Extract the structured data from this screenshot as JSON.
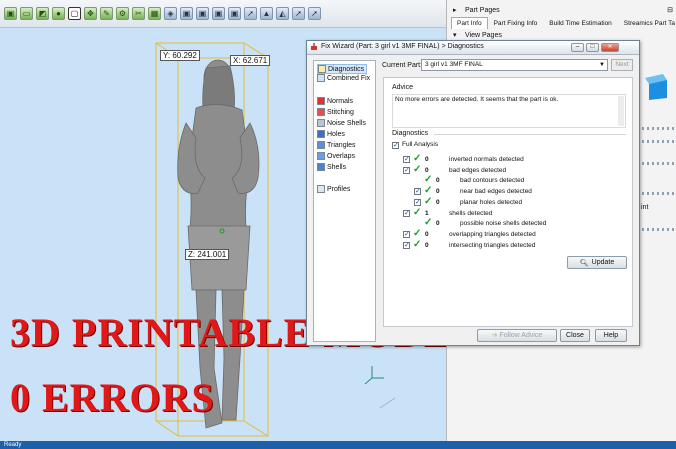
{
  "statusbar": {
    "text": "Ready"
  },
  "toolbar": {
    "icons": [
      "cube-icon",
      "sheet-icon",
      "edge-icon",
      "sphere-icon",
      "select-icon",
      "move-icon",
      "brush-icon",
      "wrench-icon",
      "scissors-icon",
      "grid-icon",
      "node-icon",
      "cube-icon",
      "cube-icon",
      "cube-icon",
      "cube-icon",
      "arrow-icon",
      "pyramid-icon",
      "triangle-icon",
      "arrow-icon",
      "arrow-icon"
    ]
  },
  "viewport": {
    "y_label": "Y: 60.292",
    "x_label": "X: 62.671",
    "z_label": "Z: 241.001",
    "overlay_line1": "3D PRINTABLE MODEL",
    "overlay_line2": "0 ERRORS",
    "overlay_color": "#e01818",
    "bbox_color": "#e8b93a"
  },
  "right_panel": {
    "part_pages_title": "Part Pages",
    "tabs": [
      "Part Info",
      "Part Fixing Info",
      "Build Time Estimation",
      "Streamics Part Ta"
    ],
    "active_tab": "Part Info",
    "view_pages_title": "View Pages",
    "side_text": "int",
    "accent": "#1e8fe0"
  },
  "dialog": {
    "title": "Fix Wizard (Part: 3 girl v1 3MF FINAL) > Diagnostics",
    "nav_items": [
      "Diagnostics",
      "Combined Fix",
      "Normals",
      "Stitching",
      "Noise Shells",
      "Holes",
      "Triangles",
      "Overlaps",
      "Shells",
      "Profiles"
    ],
    "selected_nav": "Diagnostics",
    "current_part_label": "Current Part:",
    "current_part_value": "3 girl v1 3MF FINAL",
    "next_label": "Next",
    "advice_title": "Advice",
    "advice_text": "No more errors are detected. It seems that the part is ok.",
    "diagnostics_title": "Diagnostics",
    "full_analysis_label": "Full Analysis",
    "rows": [
      {
        "count": "0",
        "label": "inverted normals detected"
      },
      {
        "count": "0",
        "label": "bad edges detected"
      },
      {
        "count": "0",
        "label": "bad contours detected"
      },
      {
        "count": "0",
        "label": "near bad edges detected"
      },
      {
        "count": "0",
        "label": "planar holes detected"
      },
      {
        "count": "1",
        "label": "shells detected"
      },
      {
        "count": "0",
        "label": "possible noise shells detected"
      },
      {
        "count": "0",
        "label": "overlapping triangles detected"
      },
      {
        "count": "0",
        "label": "intersecting triangles detected"
      }
    ],
    "update_label": "Update",
    "follow_label": "Follow Advice",
    "close_label": "Close",
    "help_label": "Help"
  }
}
